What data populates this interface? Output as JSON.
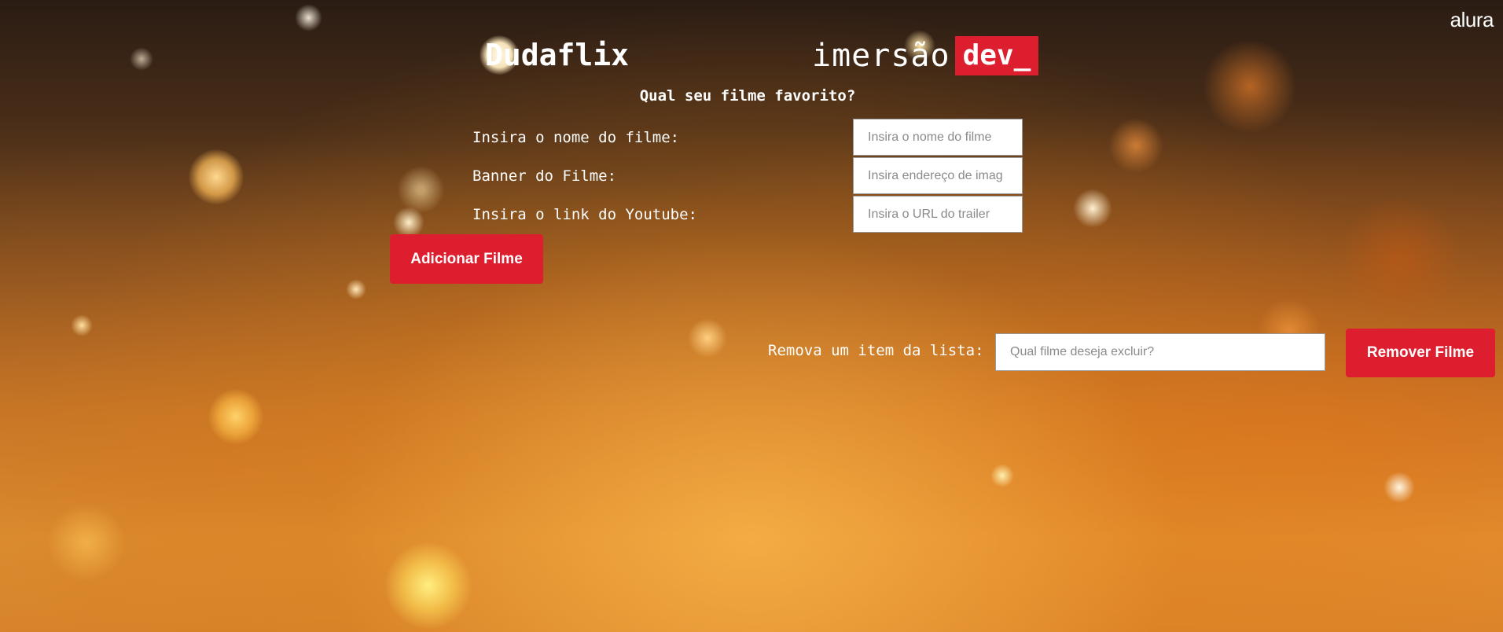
{
  "header": {
    "alura_logo": "alura",
    "brand": "Dudaflix",
    "imersao_text": "imersão",
    "imersao_badge": "dev_"
  },
  "form": {
    "question": "Qual seu filme favorito?",
    "fields": [
      {
        "label": "Insira o nome do filme:",
        "placeholder": "Insira o nome do filme",
        "value": ""
      },
      {
        "label": "Banner do Filme:",
        "placeholder": "Insira endereço de imag",
        "value": ""
      },
      {
        "label": "Insira o link do Youtube:",
        "placeholder": "Insira o URL do trailer",
        "value": ""
      }
    ],
    "add_button": "Adicionar Filme"
  },
  "remove": {
    "label": "Remova um item da lista:",
    "placeholder": "Qual filme deseja excluir?",
    "value": "",
    "button": "Remover Filme"
  },
  "colors": {
    "accent": "#dc1e2e",
    "text": "#ffffff"
  }
}
